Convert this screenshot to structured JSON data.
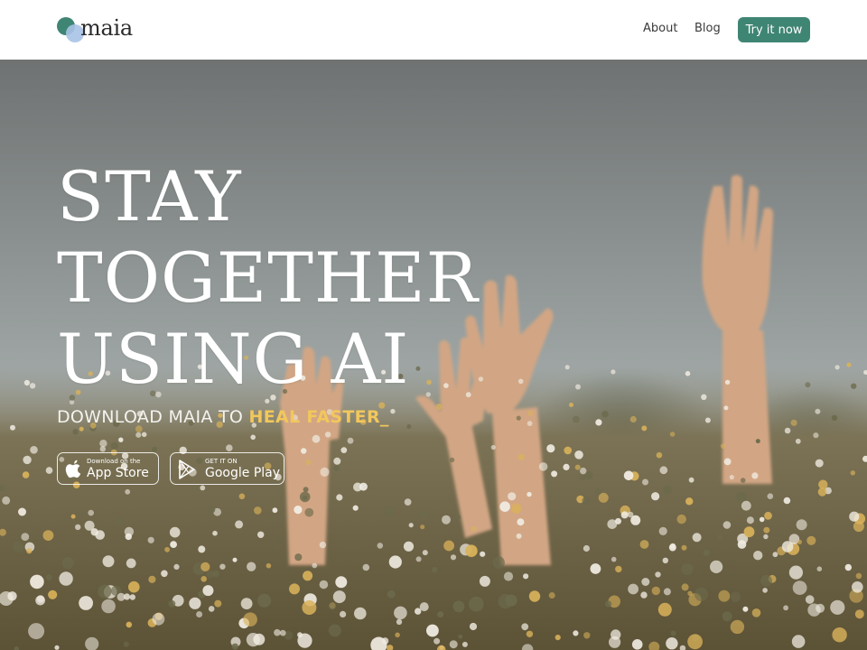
{
  "brand": {
    "name": "maia",
    "accent": "#3f8574",
    "highlight": "#f2c75c"
  },
  "nav": {
    "links": [
      "About",
      "Blog"
    ],
    "cta": "Try it now"
  },
  "hero": {
    "headline": [
      "STAY",
      "TOGETHER",
      "USING AI"
    ],
    "subline_prefix": "DOWNLOAD MAIA TO ",
    "subline_accent": "HEAL FASTER_",
    "background": "photo of raised hands above a field of chamomile flowers under a grey sky"
  },
  "stores": {
    "apple": {
      "small": "Download on the",
      "big": "App Store",
      "icon": "apple-icon"
    },
    "google": {
      "small": "GET IT ON",
      "big": "Google Play",
      "icon": "google-play-icon"
    }
  }
}
